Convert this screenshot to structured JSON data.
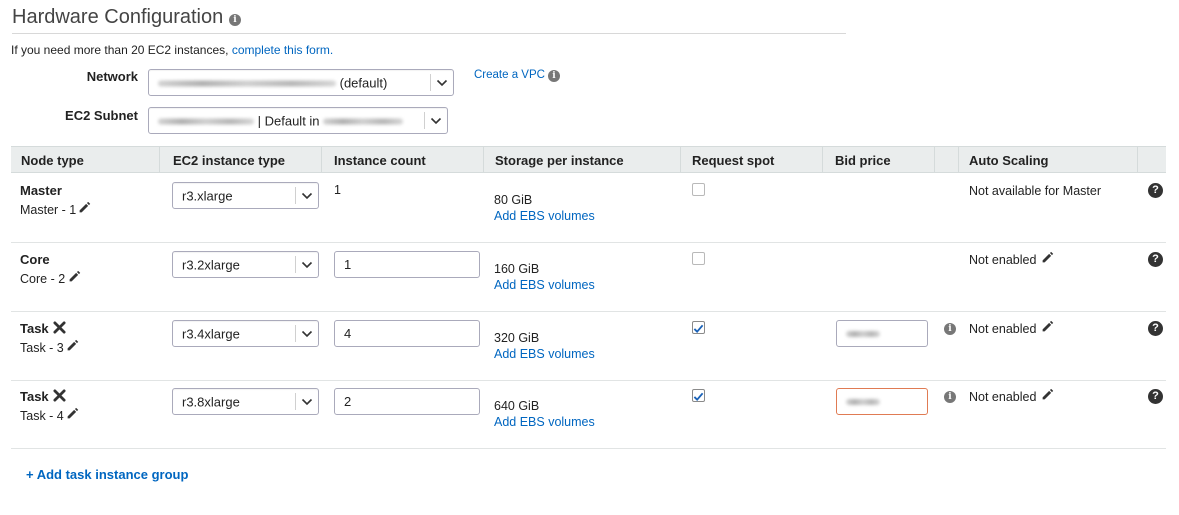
{
  "header": {
    "title": "Hardware Configuration",
    "limit_text": "If you need more than 20 EC2 instances, ",
    "limit_link": "complete this form."
  },
  "network": {
    "label": "Network",
    "selected_suffix": "(default)",
    "create_vpc_link": "Create a VPC"
  },
  "subnet": {
    "label": "EC2 Subnet",
    "selected_mid": "| Default in"
  },
  "table": {
    "columns": [
      "Node type",
      "EC2 instance type",
      "Instance count",
      "Storage per instance",
      "Request spot",
      "Bid price",
      "Auto Scaling"
    ],
    "rows": [
      {
        "node_type": "Master",
        "node_sub": "Master - 1",
        "removable": false,
        "instance_type": "r3.xlarge",
        "instance_count": "1",
        "count_editable": false,
        "storage": "80 GiB",
        "add_ebs": "Add EBS volumes",
        "request_spot": false,
        "has_bid": false,
        "auto_scaling": "Not available for Master",
        "auto_scaling_editable": false
      },
      {
        "node_type": "Core",
        "node_sub": "Core - 2",
        "removable": false,
        "instance_type": "r3.2xlarge",
        "instance_count": "1",
        "count_editable": true,
        "storage": "160 GiB",
        "add_ebs": "Add EBS volumes",
        "request_spot": false,
        "has_bid": false,
        "auto_scaling": "Not enabled",
        "auto_scaling_editable": true
      },
      {
        "node_type": "Task",
        "node_sub": "Task - 3",
        "removable": true,
        "instance_type": "r3.4xlarge",
        "instance_count": "4",
        "count_editable": true,
        "storage": "320 GiB",
        "add_ebs": "Add EBS volumes",
        "request_spot": true,
        "has_bid": true,
        "bid_error": false,
        "auto_scaling": "Not enabled",
        "auto_scaling_editable": true
      },
      {
        "node_type": "Task",
        "node_sub": "Task - 4",
        "removable": true,
        "instance_type": "r3.8xlarge",
        "instance_count": "2",
        "count_editable": true,
        "storage": "640 GiB",
        "add_ebs": "Add EBS volumes",
        "request_spot": true,
        "has_bid": true,
        "bid_error": true,
        "auto_scaling": "Not enabled",
        "auto_scaling_editable": true
      }
    ]
  },
  "add_task_group": "+ Add task instance group",
  "icons": {
    "info": "info-icon",
    "help": "question-circle-icon",
    "edit": "pencil-icon",
    "remove": "close-x-icon",
    "dropdown": "chevron-down-icon",
    "check": "checkmark-icon"
  },
  "colors": {
    "link": "#0066c0",
    "header_bg": "#eaeded",
    "error_border": "#e07b53",
    "checkbox_blue": "#1a62b8"
  }
}
